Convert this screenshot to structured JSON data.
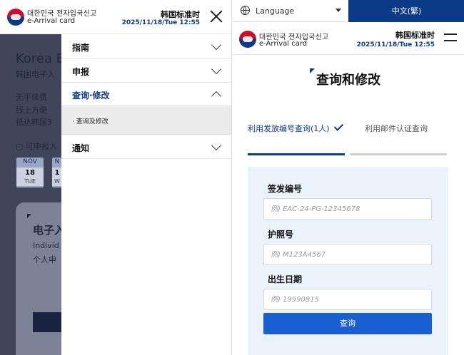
{
  "left": {
    "logo_kr": "대한민국 전자입국신고",
    "logo_en": "e-Arrival card",
    "tz_label": "韩国标准时",
    "tz_date": "2025/11/18/Tue 12:55",
    "background": {
      "title": "Korea E",
      "subtitle": "韩国电子入",
      "lines": [
        "无手续费",
        "线上方便",
        "抵达韩国3"
      ],
      "can_apply": "▢ 可申报入",
      "cal1": {
        "month": "NOV",
        "day": "18",
        "weekday": "TUE"
      },
      "cal2": {
        "month": "N",
        "day": "1",
        "weekday": "W"
      },
      "card_title": "电子入",
      "card_line1": "Individ",
      "card_line2": "个人申"
    },
    "menu": [
      {
        "label": "指南",
        "expanded": false
      },
      {
        "label": "申报",
        "expanded": false
      },
      {
        "label": "查询·修改",
        "expanded": true
      },
      {
        "label": "通知",
        "expanded": false
      }
    ],
    "submenu_item": "· 查询及修改"
  },
  "right": {
    "language_label": "Language",
    "language_button": "中文(繁)",
    "logo_kr": "대한민국 전자입국신고",
    "logo_en": "e-Arrival card",
    "tz_label": "韩国标准时",
    "tz_date": "2025/11/18/Tue 12:55",
    "page_title": "查询和修改",
    "tabs": [
      "利用发放编号查询(1人)",
      "利用邮件认证查询"
    ],
    "form": {
      "issue_label": "签发编号",
      "issue_placeholder": "例) EAC-24-PG-12345678",
      "passport_label": "护照号",
      "passport_placeholder": "例) M123A4567",
      "birth_label": "出生日期",
      "birth_placeholder": "例) 19990815",
      "submit_label": "查询"
    }
  },
  "colors": {
    "brand_blue": "#0b3a86",
    "button_blue": "#1a5fd1",
    "overlay": "#3f4659",
    "form_bg": "#eaf2fb"
  }
}
